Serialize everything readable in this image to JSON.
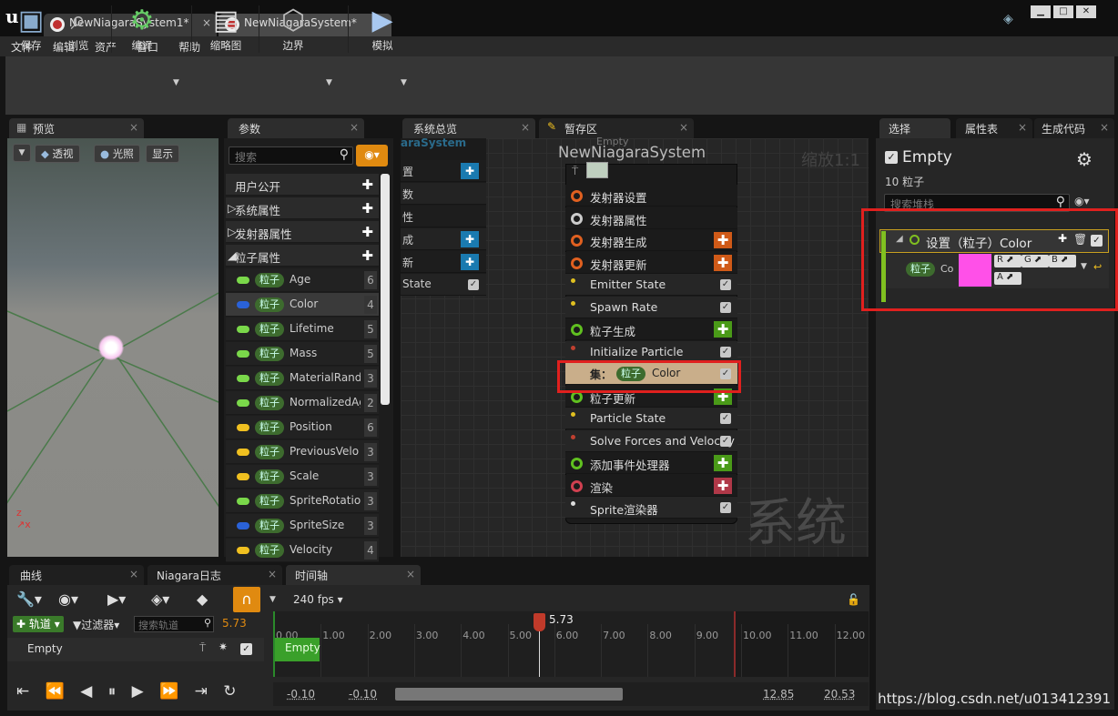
{
  "tabs": [
    {
      "label": "NewNiagaraSystem1*"
    },
    {
      "label": "NewNiagaraSystem*"
    }
  ],
  "menu": [
    "文件",
    "编辑",
    "资产",
    "窗口",
    "帮助"
  ],
  "toolbar": {
    "save": "保存",
    "browse": "浏览",
    "compile": "编译",
    "thumbnail": "缩略图",
    "bounds": "边界",
    "simulate": "模拟"
  },
  "preview": {
    "tab": "预览",
    "perspective": "透视",
    "lit": "光照",
    "show": "显示"
  },
  "params": {
    "tab": "参数",
    "search_placeholder": "搜索",
    "sections": [
      "用户公开",
      "系统属性",
      "发射器属性",
      "粒子属性"
    ],
    "attrs": [
      {
        "name": "Age",
        "num": "6",
        "color": "#7ad84a"
      },
      {
        "name": "Color",
        "num": "4",
        "color": "#2a62d8"
      },
      {
        "name": "Lifetime",
        "num": "5",
        "color": "#7ad84a"
      },
      {
        "name": "Mass",
        "num": "5",
        "color": "#7ad84a"
      },
      {
        "name": "MaterialRand",
        "num": "3",
        "color": "#7ad84a"
      },
      {
        "name": "NormalizedAg",
        "num": "2",
        "color": "#7ad84a"
      },
      {
        "name": "Position",
        "num": "6",
        "color": "#f0c020"
      },
      {
        "name": "PreviousVelo",
        "num": "3",
        "color": "#f0c020"
      },
      {
        "name": "Scale",
        "num": "3",
        "color": "#f0c020"
      },
      {
        "name": "SpriteRotatio",
        "num": "3",
        "color": "#7ad84a"
      },
      {
        "name": "SpriteSize",
        "num": "3",
        "color": "#2a62d8"
      },
      {
        "name": "Velocity",
        "num": "4",
        "color": "#f0c020"
      }
    ],
    "pill": "粒子"
  },
  "graph": {
    "tab_overview": "系统总览",
    "tab_scratch": "暂存区",
    "system_name": "NewNiagaraSystem",
    "zoom": "缩放1:1",
    "watermark": "系统",
    "empty_label": "Empty",
    "left_node_title": "araSystem",
    "left_rows": [
      "置",
      "数",
      "性",
      "成",
      "新",
      "State"
    ],
    "rows": [
      {
        "label": "发射器设置",
        "kind": "header",
        "color": "#e06020"
      },
      {
        "label": "发射器属性",
        "kind": "header",
        "color": "#cccccc"
      },
      {
        "label": "发射器生成",
        "kind": "plus",
        "color": "#e06020",
        "btn": "#d05a18"
      },
      {
        "label": "发射器更新",
        "kind": "plus",
        "color": "#e06020",
        "btn": "#d05a18"
      },
      {
        "label": "Emitter State",
        "kind": "check",
        "color": "#e0c020"
      },
      {
        "label": "Spawn Rate",
        "kind": "check",
        "color": "#e0c020"
      },
      {
        "label": "粒子生成",
        "kind": "plus",
        "color": "#60c020",
        "btn": "#4a9a18"
      },
      {
        "label": "Initialize Particle",
        "kind": "check",
        "color": "#c04030"
      },
      {
        "label": "Color",
        "kind": "set",
        "color": "#d0c0a0",
        "prefix": "集：",
        "pill": "粒子"
      },
      {
        "label": "粒子更新",
        "kind": "plus",
        "color": "#60c020",
        "btn": "#4a9a18"
      },
      {
        "label": "Particle State",
        "kind": "check",
        "color": "#e0c020"
      },
      {
        "label": "Solve Forces and Velocity",
        "kind": "check",
        "color": "#c04030"
      },
      {
        "label": "添加事件处理器",
        "kind": "plus",
        "color": "#60c020",
        "btn": "#4a9a18"
      },
      {
        "label": "渲染",
        "kind": "plus",
        "color": "#d04050",
        "btn": "#b03848"
      },
      {
        "label": "Sprite渲染器",
        "kind": "check",
        "color": "#dddddd"
      }
    ]
  },
  "right": {
    "tabs": [
      "选择",
      "属性表",
      "生成代码"
    ],
    "title": "Empty",
    "subtitle": "10 粒子",
    "search_placeholder": "搜索堆栈",
    "module_title": "设置（粒子）Color",
    "module_pill": "粒子",
    "module_param": "Co",
    "channels": [
      "R",
      "G",
      "B",
      "A"
    ],
    "swatch": "#ff50e8"
  },
  "timeline": {
    "tabs": [
      "曲线",
      "Niagara日志",
      "时间轴"
    ],
    "fps": "240 fps",
    "track_btn": "轨道",
    "filter_btn": "过滤器",
    "search_placeholder": "搜索轨道",
    "time": "5.73",
    "track_name": "Empty",
    "playhead": "5.73",
    "ticks": [
      "0.00",
      "1.00",
      "2.00",
      "3.00",
      "4.00",
      "5.00",
      "6.00",
      "7.00",
      "8.00",
      "9.00",
      "10.00",
      "11.00",
      "12.00"
    ],
    "range_left": "-0.10",
    "range_left2": "-0.10",
    "range_right": "12.85",
    "range_right2": "20.53"
  },
  "watermark": "https://blog.csdn.net/u013412391"
}
